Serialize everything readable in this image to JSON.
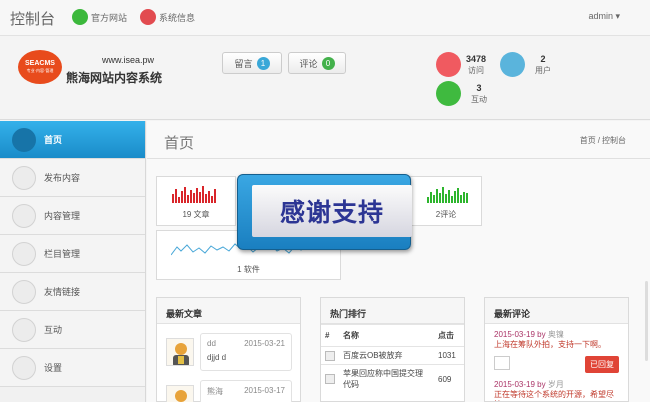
{
  "topbar": {
    "brand": "控制台",
    "links": [
      {
        "label": "官方网站",
        "color": "#3cb83c"
      },
      {
        "label": "系统信息",
        "color": "#e24b50"
      }
    ],
    "user": "admin ▾"
  },
  "header": {
    "logo_text": "SEACMS",
    "logo_sub": "专业·内容·管理",
    "site_url": "www.isea.pw",
    "site_name": "熊海网站内容系统",
    "buttons": [
      {
        "label": "留言",
        "count": "1",
        "badge_color": "#3aa8d8"
      },
      {
        "label": "评论",
        "count": "0",
        "badge_color": "#43b14b"
      }
    ],
    "stats": [
      {
        "value": "3478",
        "label": "访问",
        "color": "#f05a60"
      },
      {
        "value": "2",
        "label": "用户",
        "color": "#5ab4dc"
      },
      {
        "value": "3",
        "label": "互动",
        "color": "#3fba3f"
      }
    ]
  },
  "sidebar": {
    "items": [
      {
        "label": "首页",
        "active": true
      },
      {
        "label": "发布内容"
      },
      {
        "label": "内容管理"
      },
      {
        "label": "栏目管理"
      },
      {
        "label": "友情链接"
      },
      {
        "label": "互动"
      },
      {
        "label": "设置"
      }
    ]
  },
  "main": {
    "title": "首页",
    "breadcrumb": [
      "首页",
      "/",
      "控制台"
    ]
  },
  "summary": {
    "articles": "19 文章",
    "comments": "2评论",
    "software": "1 软件"
  },
  "overlay": {
    "text": "感谢支持"
  },
  "latest_articles": {
    "title": "最新文章",
    "items": [
      {
        "author": "dd",
        "date": "2015-03-21",
        "text": "djjd d"
      },
      {
        "author": "熊海",
        "date": "2015-03-17",
        "text": ""
      }
    ]
  },
  "hot_rank": {
    "title": "热门排行",
    "columns": [
      "#",
      "名称",
      "点击"
    ],
    "rows": [
      {
        "name": "百度云OB被放弃",
        "hits": "1031"
      },
      {
        "name": "苹果回应称中国提交理代码",
        "hits": "609"
      }
    ]
  },
  "latest_comments": {
    "title": "最新评论",
    "items": [
      {
        "date": "2015-03-19 by",
        "user": "奥镍",
        "text": "上海在筹队外拍，支持一下啊。"
      },
      {
        "date": "2015-03-19 by",
        "user": "岁月",
        "text": "正在等待这个系统的开源，希望尽快"
      }
    ],
    "reply_label": "已回复"
  },
  "colors": {
    "accent": "#1f95d4",
    "bar_red": "#d9252a",
    "bar_green": "#2db52d",
    "line_blue": "#4aa8d8"
  }
}
